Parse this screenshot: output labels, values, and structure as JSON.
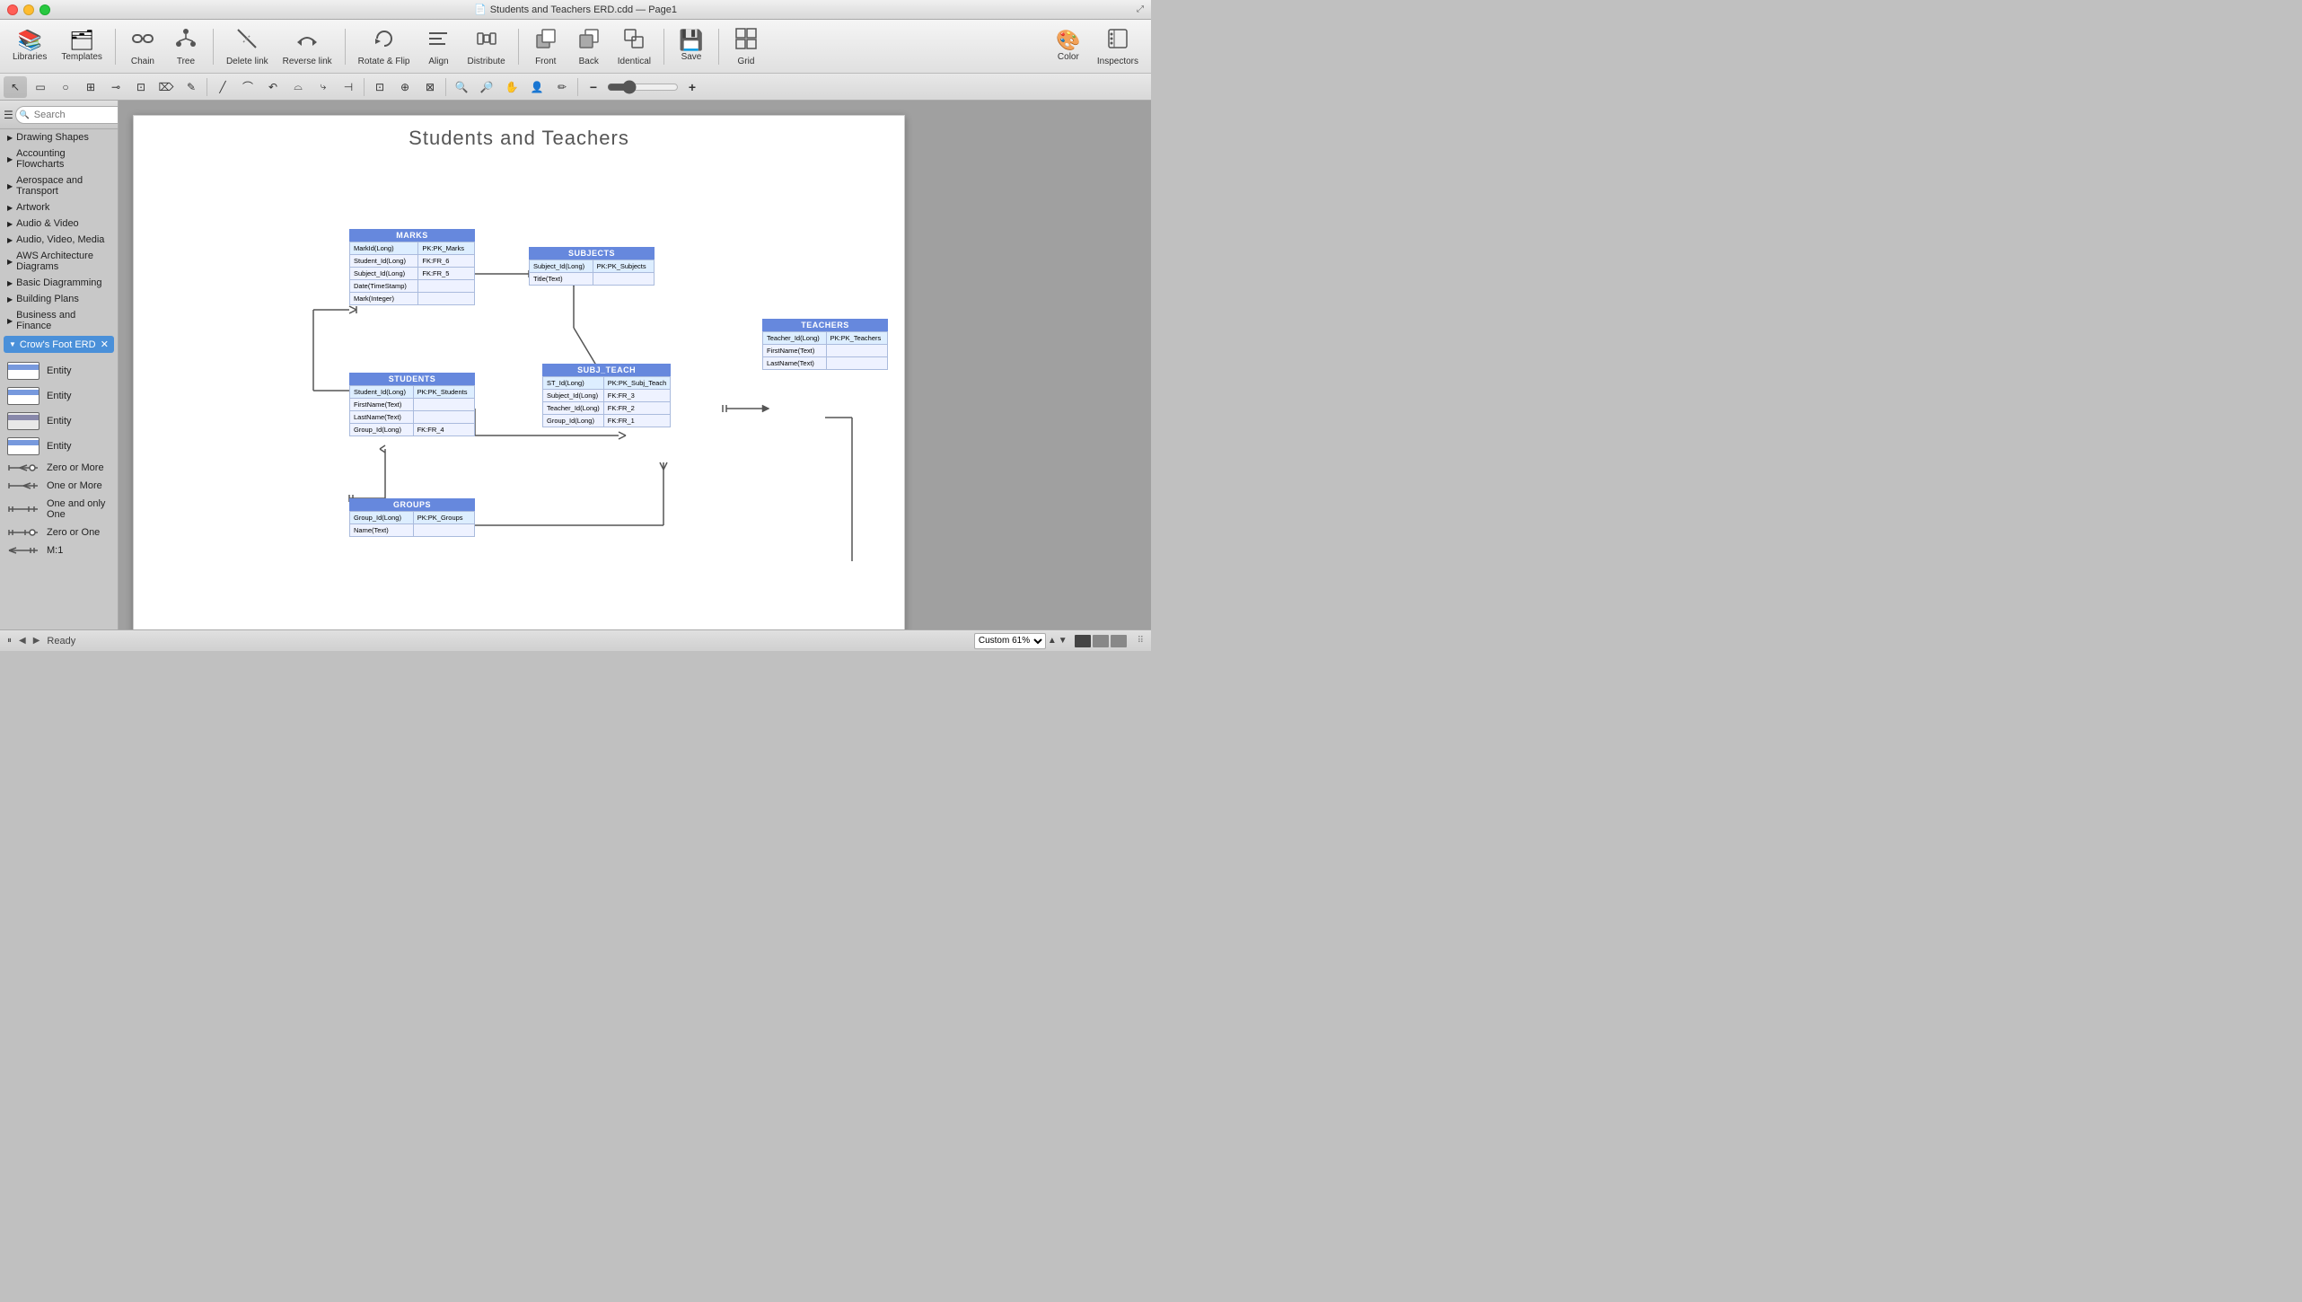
{
  "window": {
    "title": "Students and Teachers ERD.cdd — Page1",
    "pdf_icon": "📄"
  },
  "traffic_lights": {
    "close": "close",
    "minimize": "minimize",
    "maximize": "maximize"
  },
  "toolbar": {
    "buttons": [
      {
        "id": "libraries",
        "label": "Libraries",
        "icon": "📚"
      },
      {
        "id": "templates",
        "label": "Templates",
        "icon": "🗂"
      },
      {
        "id": "chain",
        "label": "Chain",
        "icon": "🔗"
      },
      {
        "id": "tree",
        "label": "Tree",
        "icon": "🌲"
      },
      {
        "id": "delete-link",
        "label": "Delete link",
        "icon": "✂"
      },
      {
        "id": "reverse-link",
        "label": "Reverse link",
        "icon": "↩"
      },
      {
        "id": "rotate-flip",
        "label": "Rotate & Flip",
        "icon": "↻"
      },
      {
        "id": "align",
        "label": "Align",
        "icon": "≡"
      },
      {
        "id": "distribute",
        "label": "Distribute",
        "icon": "⠿"
      },
      {
        "id": "front",
        "label": "Front",
        "icon": "⬆"
      },
      {
        "id": "back",
        "label": "Back",
        "icon": "⬇"
      },
      {
        "id": "identical",
        "label": "Identical",
        "icon": "⧉"
      },
      {
        "id": "save",
        "label": "Save",
        "icon": "💾"
      },
      {
        "id": "grid",
        "label": "Grid",
        "icon": "⊞"
      },
      {
        "id": "color",
        "label": "Color",
        "icon": "🎨"
      },
      {
        "id": "inspectors",
        "label": "Inspectors",
        "icon": "🔍"
      }
    ]
  },
  "sidebar": {
    "search_placeholder": "Search",
    "categories": [
      {
        "label": "Drawing Shapes",
        "expanded": false
      },
      {
        "label": "Accounting Flowcharts",
        "expanded": false
      },
      {
        "label": "Aerospace and Transport",
        "expanded": false
      },
      {
        "label": "Artwork",
        "expanded": false
      },
      {
        "label": "Audio & Video",
        "expanded": false
      },
      {
        "label": "Audio, Video, Media",
        "expanded": false
      },
      {
        "label": "AWS Architecture Diagrams",
        "expanded": false
      },
      {
        "label": "Basic Diagramming",
        "expanded": false
      },
      {
        "label": "Building Plans",
        "expanded": false
      },
      {
        "label": "Business and Finance",
        "expanded": false
      }
    ],
    "active_library": "Crow's Foot ERD",
    "shapes": [
      {
        "label": "Entity",
        "type": "rect-striped"
      },
      {
        "label": "Entity",
        "type": "rect-striped-2"
      },
      {
        "label": "Entity",
        "type": "rect-striped-3"
      },
      {
        "label": "Entity",
        "type": "rect-striped-4"
      },
      {
        "label": "Zero or More",
        "type": "line-crow"
      },
      {
        "label": "One or More",
        "type": "line-one-more"
      },
      {
        "label": "One and only One",
        "type": "line-one-one"
      },
      {
        "label": "Zero or One",
        "type": "line-zero-one"
      },
      {
        "label": "M:1",
        "type": "line-m1"
      }
    ]
  },
  "canvas": {
    "title": "Students and Teachers",
    "page": "Page1",
    "zoom": "Custom 61%"
  },
  "erd": {
    "marks": {
      "title": "MARKS",
      "rows": [
        [
          "MarkId(Long)",
          "PK:PK_Marks"
        ],
        [
          "Student_Id(Long)",
          "FK:FR_6"
        ],
        [
          "Subject_Id(Long)",
          "FK:FR_5"
        ],
        [
          "Date(TimeStamp)",
          ""
        ],
        [
          "Mark(Integer)",
          ""
        ]
      ]
    },
    "subjects": {
      "title": "SUBJECTS",
      "rows": [
        [
          "Subject_Id(Long)",
          "PK:PK_Subjects"
        ],
        [
          "Title(Text)",
          ""
        ]
      ]
    },
    "students": {
      "title": "STUDENTS",
      "rows": [
        [
          "Student_Id(Long)",
          "PK:PK_Students"
        ],
        [
          "FirstName(Text)",
          ""
        ],
        [
          "LastName(Text)",
          ""
        ],
        [
          "Group_Id(Long)",
          "FK:FR_4"
        ]
      ]
    },
    "subj_teach": {
      "title": "SUBJ_TEACH",
      "rows": [
        [
          "ST_Id(Long)",
          "PK:PK_Subj_Teach"
        ],
        [
          "Subject_Id(Long)",
          "FK:FR_3"
        ],
        [
          "Teacher_Id(Long)",
          "FK:FR_2"
        ],
        [
          "Group_Id(Long)",
          "FK:FR_1"
        ]
      ]
    },
    "teachers": {
      "title": "TEACHERS",
      "rows": [
        [
          "Teacher_Id(Long)",
          "PK:PK_Teachers"
        ],
        [
          "FirstName(Text)",
          ""
        ],
        [
          "LastName(Text)",
          ""
        ]
      ]
    },
    "groups": {
      "title": "GROUPS",
      "rows": [
        [
          "Group_Id(Long)",
          "PK:PK_Groups"
        ],
        [
          "Name(Text)",
          ""
        ]
      ]
    }
  },
  "statusbar": {
    "status": "Ready",
    "zoom": "Custom 61%"
  }
}
